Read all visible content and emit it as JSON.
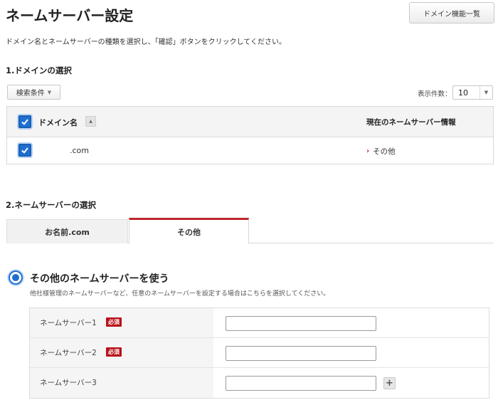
{
  "header": {
    "title": "ネームサーバー設定",
    "domain_list_button": "ドメイン機能一覧"
  },
  "instructions": "ドメイン名とネームサーバーの種類を選択し、「確認」ボタンをクリックしてください。",
  "domain_section": {
    "heading": "1.ドメインの選択",
    "search_button": "検索条件",
    "count_label": "表示件数：",
    "count_value": "10",
    "table": {
      "columns": [
        "ドメイン名",
        "現在のネームサーバー情報"
      ],
      "rows": [
        {
          "checked": true,
          "domain": ".com",
          "nameserver": "その他"
        }
      ]
    }
  },
  "ns_section": {
    "heading": "2.ネームサーバーの選択",
    "tabs": [
      {
        "label": "お名前.com",
        "active": false
      },
      {
        "label": "その他",
        "active": true
      }
    ],
    "option": {
      "label": "その他のネームサーバーを使う",
      "description": "他社様管理のネームサーバーなど、任意のネームサーバーを設定する場合はこちらを選択してください。",
      "selected": true
    },
    "fields": [
      {
        "label": "ネームサーバー1",
        "required_badge": "必須",
        "value": ""
      },
      {
        "label": "ネームサーバー2",
        "required_badge": "必須",
        "value": ""
      },
      {
        "label": "ネームサーバー3",
        "value": ""
      }
    ],
    "add_button": "+"
  },
  "colors": {
    "accent_blue": "#1f6fd1",
    "accent_red": "#c0262d",
    "required_red": "#b8121a"
  },
  "icons": {
    "sort": "sort-icon",
    "chevron": "chevron-right-icon",
    "check": "check-icon",
    "caret": "caret-down-icon"
  }
}
